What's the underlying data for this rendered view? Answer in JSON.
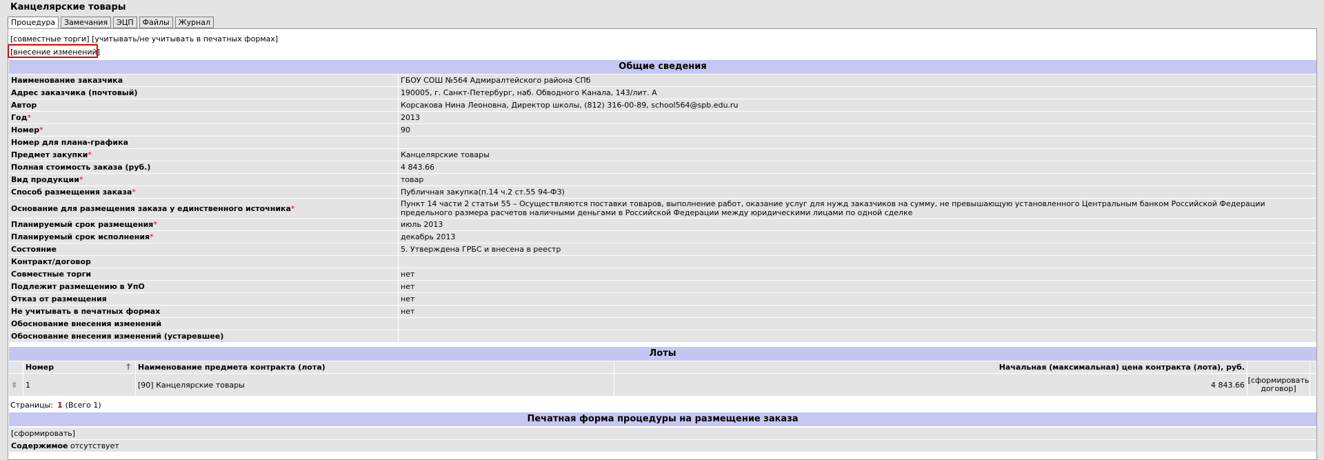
{
  "title": "Канцелярские товары",
  "tabs": [
    {
      "label": "Процедура",
      "active": true
    },
    {
      "label": "Замечания",
      "active": false
    },
    {
      "label": "ЭЦП",
      "active": false
    },
    {
      "label": "Файлы",
      "active": false
    },
    {
      "label": "Журнал",
      "active": false
    }
  ],
  "actions": {
    "joint_bidding": "[совместные торги]",
    "print_toggle": "[учитывать/не учитывать в печатных формах]",
    "make_changes": "[внесение изменений]"
  },
  "general": {
    "header": "Общие сведения",
    "rows": [
      {
        "label": "Наименование заказчика",
        "required": "",
        "value": "ГБОУ СОШ №564 Адмиралтейского района СПб"
      },
      {
        "label": "Адрес заказчика (почтовый)",
        "required": "",
        "value": "190005, г. Санкт-Петербург, наб. Обводного Канала, 143/лит. А"
      },
      {
        "label": "Автор",
        "required": "",
        "value": "Корсакова Нина Леоновна, Директор школы, (812) 316-00-89, school564@spb.edu.ru"
      },
      {
        "label": "Год",
        "required": "*",
        "value": "2013"
      },
      {
        "label": "Номер",
        "required": "*",
        "value": "90"
      },
      {
        "label": "Номер для плана-графика",
        "required": "",
        "value": ""
      },
      {
        "label": "Предмет закупки",
        "required": "*",
        "value": "Канцелярские товары"
      },
      {
        "label": "Полная стоимость заказа (руб.)",
        "required": "",
        "value": "4 843.66"
      },
      {
        "label": "Вид продукции",
        "required": "*",
        "value": "товар"
      },
      {
        "label": "Способ размещения заказа",
        "required": "*",
        "value": "Публичная закупка(п.14 ч.2 ст.55 94-ФЗ)"
      },
      {
        "label": "Основание для размещения заказа у единственного источника",
        "required": "*",
        "value": "Пункт 14 части 2 статьи 55 – Осуществляются поставки товаров, выполнение работ, оказание услуг для нужд заказчиков на сумму, не превышающую установленного Центральным банком Российской Федерации предельного размера расчетов наличными деньгами в Российской Федерации между юридическими лицами по одной сделке",
        "tall": true
      },
      {
        "label": "Планируемый срок размещения",
        "required": "*",
        "value": "июль 2013"
      },
      {
        "label": "Планируемый срок исполнения",
        "required": "*",
        "value": "декабрь 2013"
      },
      {
        "label": "Состояние",
        "required": "",
        "value": "5. Утверждена ГРБС и внесена в реестр"
      },
      {
        "label": "Контракт/договор",
        "required": "",
        "value": ""
      },
      {
        "label": "Совместные торги",
        "required": "",
        "value": "нет"
      },
      {
        "label": "Подлежит размещению в УпО",
        "required": "",
        "value": "нет"
      },
      {
        "label": "Отказ от размещения",
        "required": "",
        "value": "нет"
      },
      {
        "label": "Не учитывать в печатных формах",
        "required": "",
        "value": "нет"
      },
      {
        "label": "Обоснование внесения изменений",
        "required": "",
        "value": ""
      },
      {
        "label": "Обоснование внесения изменений (устаревшее)",
        "required": "",
        "value": ""
      }
    ]
  },
  "lots": {
    "header": "Лоты",
    "columns": {
      "number": "Номер",
      "name": "Наименование предмета контракта (лота)",
      "price": "Начальная (максимальная) цена контракта (лота), руб."
    },
    "rows": [
      {
        "number": "1",
        "name": "[90] Канцелярские товары",
        "price": "4 843.66",
        "action": "[сформировать договор]"
      }
    ],
    "pages_label": "Страницы:",
    "current_page": "1",
    "total": "(Всего 1)"
  },
  "print_form": {
    "header": "Печатная форма процедуры на размещение заказа",
    "generate": "[сформировать]",
    "content_label": "Содержимое",
    "content_value": "отсутствует"
  }
}
